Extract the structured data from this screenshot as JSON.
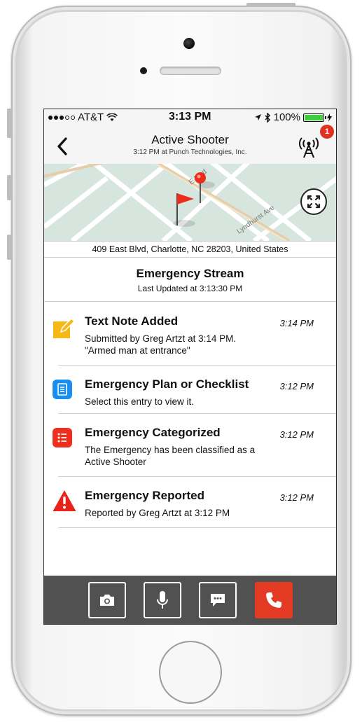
{
  "status_bar": {
    "carrier": "AT&T",
    "time": "3:13 PM",
    "battery": "100%",
    "battery_color": "#3fcc3f"
  },
  "nav": {
    "title": "Active Shooter",
    "subtitle": "3:12 PM at Punch Technologies, Inc.",
    "back_icon": "chevron-left-icon",
    "tower_icon": "radio-tower-icon",
    "badge_count": "1"
  },
  "map": {
    "street_labels": [
      "E Blvd",
      "Lyndhurst Ave"
    ],
    "expand_icon": "expand-arrows-icon"
  },
  "address": "409 East Blvd, Charlotte, NC  28203, United States",
  "stream": {
    "title": "Emergency Stream",
    "subtitle": "Last Updated at 3:13:30 PM"
  },
  "entries": [
    {
      "icon": "pencil-note-icon",
      "icon_color": "#f5b814",
      "title": "Text Note Added",
      "time": "3:14 PM",
      "line1": "Submitted by Greg Artzt at 3:14 PM.",
      "line2": "\"Armed man at entrance\""
    },
    {
      "icon": "checklist-icon",
      "icon_color": "#1a8ef0",
      "title": "Emergency Plan or Checklist",
      "time": "3:12 PM",
      "line1": "Select this entry to view it."
    },
    {
      "icon": "list-icon",
      "icon_color": "#f02e1d",
      "title": "Emergency Categorized",
      "time": "3:12 PM",
      "line1": "The Emergency has been classified as a",
      "line2": "Active Shooter"
    },
    {
      "icon": "warning-triangle-icon",
      "icon_color": "#e8231a",
      "title": "Emergency Reported",
      "time": "3:12 PM",
      "line1": "Reported by Greg Artzt at 3:12 PM"
    }
  ],
  "toolbar": {
    "buttons": [
      "camera-icon",
      "microphone-icon",
      "chat-bubble-icon",
      "phone-icon"
    ],
    "call_color": "#e33b24"
  }
}
